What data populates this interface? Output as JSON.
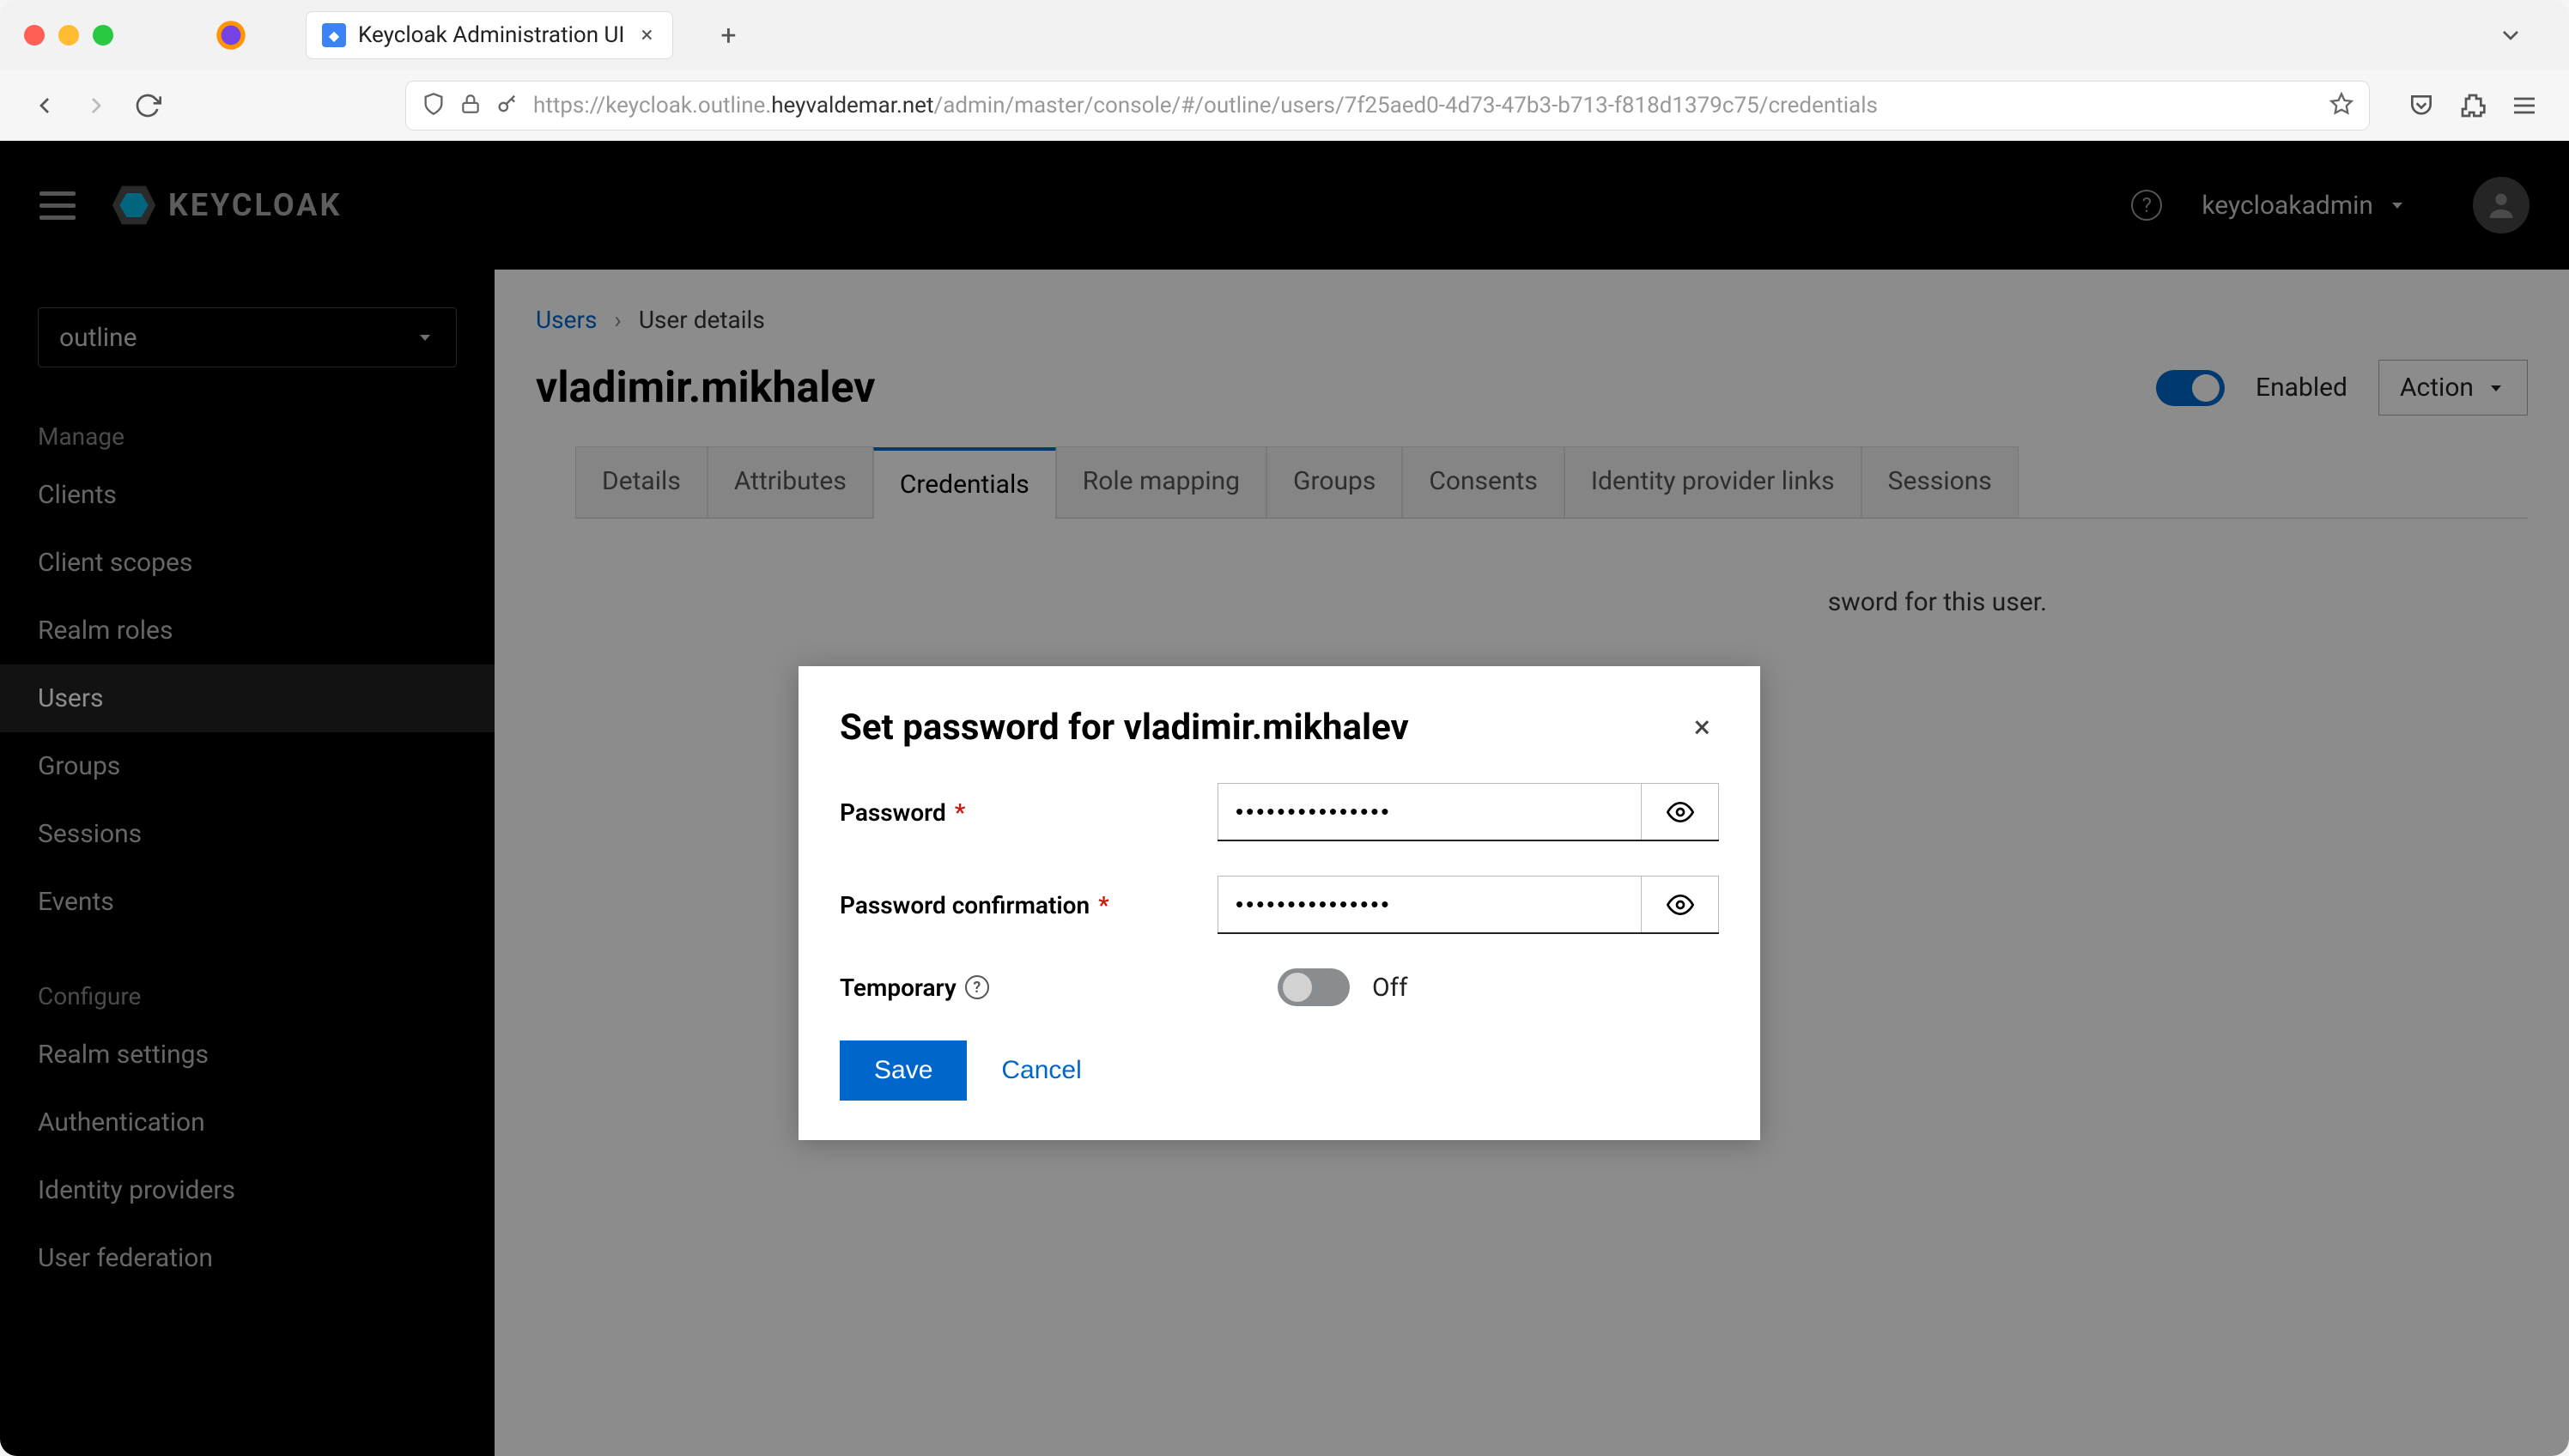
{
  "browser": {
    "tab_title": "Keycloak Administration UI",
    "url_pre": "https://keycloak.outline.",
    "url_host": "heyvaldemar.net",
    "url_post": "/admin/master/console/#/outline/users/7f25aed0-4d73-47b3-b713-f818d1379c75/credentials"
  },
  "header": {
    "logo_text": "KEYCLOAK",
    "username": "keycloakadmin"
  },
  "sidebar": {
    "realm": "outline",
    "section_manage": "Manage",
    "items_manage": [
      "Clients",
      "Client scopes",
      "Realm roles",
      "Users",
      "Groups",
      "Sessions",
      "Events"
    ],
    "active_manage_index": 3,
    "section_configure": "Configure",
    "items_configure": [
      "Realm settings",
      "Authentication",
      "Identity providers",
      "User federation"
    ]
  },
  "breadcrumb": {
    "root": "Users",
    "current": "User details"
  },
  "page": {
    "title": "vladimir.mikhalev",
    "enabled_label": "Enabled",
    "action_label": "Action"
  },
  "tabs": {
    "items": [
      "Details",
      "Attributes",
      "Credentials",
      "Role mapping",
      "Groups",
      "Consents",
      "Identity provider links",
      "Sessions"
    ],
    "active_index": 2
  },
  "credentials_hint_suffix": "sword for this user.",
  "modal": {
    "title": "Set password for vladimir.mikhalev",
    "password_label": "Password",
    "password_value": "•••••••••••••••",
    "confirm_label": "Password confirmation",
    "confirm_value": "•••••••••••••••",
    "temporary_label": "Temporary",
    "temporary_value": "Off",
    "save": "Save",
    "cancel": "Cancel"
  }
}
